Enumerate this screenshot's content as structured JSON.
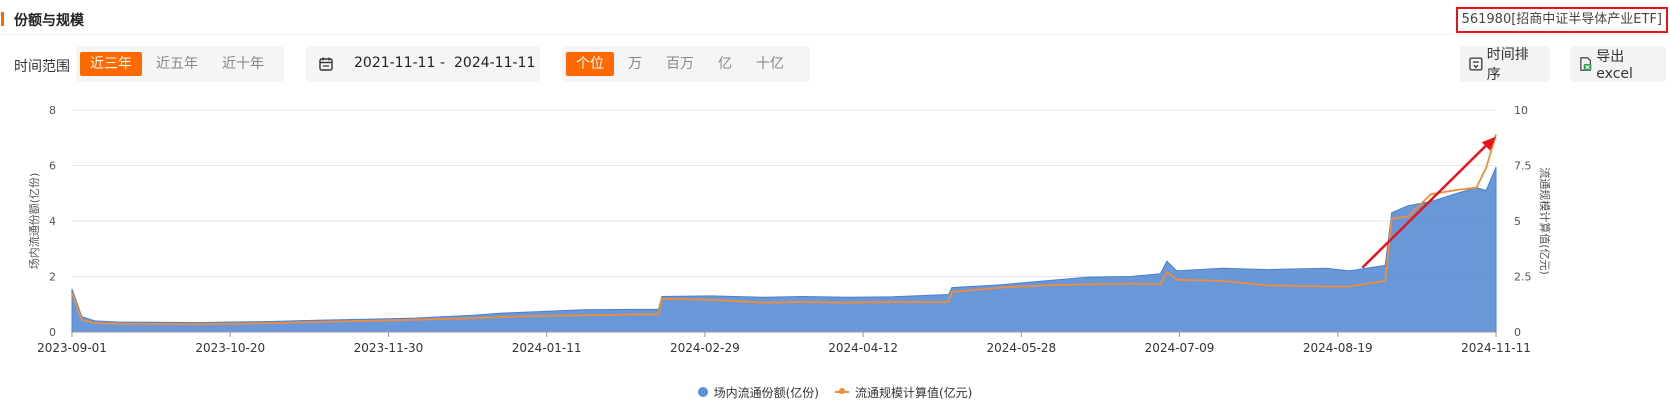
{
  "header": {
    "title": "份额与规模",
    "fund_name": "561980[招商中证半导体产业ETF]"
  },
  "toolbar": {
    "range_label": "时间范围",
    "range_options": [
      "近三年",
      "近五年",
      "近十年"
    ],
    "range_active": 0,
    "date_start": "2021-11-11",
    "date_sep": "-",
    "date_end": "2024-11-11",
    "unit_options": [
      "个位",
      "万",
      "百万",
      "亿",
      "十亿"
    ],
    "unit_active": 0,
    "sort_label": "时间排序",
    "export_label": "导出excel"
  },
  "colors": {
    "accent": "#ff6a00",
    "area": "#5b8fd6",
    "line": "#f28c38",
    "arrow": "#e8141a",
    "grid": "#e6e6e6"
  },
  "chart_data": {
    "type": "area",
    "x_ticks": [
      "2023-09-01",
      "2023-10-20",
      "2023-11-30",
      "2024-01-11",
      "2024-02-29",
      "2024-04-12",
      "2024-05-28",
      "2024-07-09",
      "2024-08-19",
      "2024-11-11"
    ],
    "x": [
      "2023-09-01",
      "2023-09-04",
      "2023-09-08",
      "2023-09-15",
      "2023-09-25",
      "2023-10-10",
      "2023-10-20",
      "2023-11-01",
      "2023-11-15",
      "2023-11-30",
      "2023-12-15",
      "2024-01-02",
      "2024-01-11",
      "2024-01-25",
      "2024-02-05",
      "2024-02-28",
      "2024-02-29",
      "2024-03-15",
      "2024-04-01",
      "2024-04-12",
      "2024-04-26",
      "2024-05-10",
      "2024-05-27",
      "2024-05-28",
      "2024-06-12",
      "2024-06-26",
      "2024-07-09",
      "2024-07-22",
      "2024-07-31",
      "2024-08-02",
      "2024-08-05",
      "2024-08-19",
      "2024-09-02",
      "2024-09-20",
      "2024-09-27",
      "2024-10-08",
      "2024-10-10",
      "2024-10-15",
      "2024-10-22",
      "2024-10-30",
      "2024-11-05",
      "2024-11-08",
      "2024-11-11"
    ],
    "series": [
      {
        "name": "场内流通份额(亿份)",
        "axis": "left",
        "values": [
          1.55,
          0.55,
          0.4,
          0.36,
          0.35,
          0.34,
          0.36,
          0.38,
          0.42,
          0.46,
          0.5,
          0.6,
          0.68,
          0.75,
          0.8,
          0.82,
          1.28,
          1.3,
          1.25,
          1.28,
          1.25,
          1.27,
          1.35,
          1.6,
          1.7,
          1.85,
          1.98,
          2.0,
          2.1,
          2.55,
          2.2,
          2.3,
          2.25,
          2.3,
          2.2,
          2.4,
          4.3,
          4.55,
          4.7,
          5.0,
          5.2,
          5.1,
          5.95
        ]
      },
      {
        "name": "流通规模计算值(亿元)",
        "axis": "right",
        "values": [
          1.75,
          0.55,
          0.4,
          0.38,
          0.36,
          0.35,
          0.37,
          0.4,
          0.45,
          0.5,
          0.55,
          0.62,
          0.68,
          0.73,
          0.75,
          0.8,
          1.5,
          1.45,
          1.32,
          1.35,
          1.32,
          1.35,
          1.35,
          1.8,
          2.0,
          2.1,
          2.15,
          2.18,
          2.15,
          2.7,
          2.35,
          2.3,
          2.1,
          2.05,
          2.05,
          2.3,
          5.1,
          5.2,
          6.2,
          6.4,
          6.5,
          7.4,
          8.9
        ]
      }
    ],
    "y_left": {
      "label": "场内流通份额(亿份)",
      "min": 0,
      "max": 8,
      "ticks": [
        0,
        2,
        4,
        6,
        8
      ]
    },
    "y_right": {
      "label": "流通规模计算值(亿元)",
      "min": 0,
      "max": 10,
      "ticks": [
        "0",
        "2.5",
        "5",
        "7.5",
        "10"
      ]
    },
    "arrow": {
      "from": [
        "2024-10-01",
        2.9
      ],
      "to": [
        "2024-11-11",
        8.8
      ],
      "axis": "right"
    },
    "grid": true,
    "legend_position": "bottom-center"
  }
}
